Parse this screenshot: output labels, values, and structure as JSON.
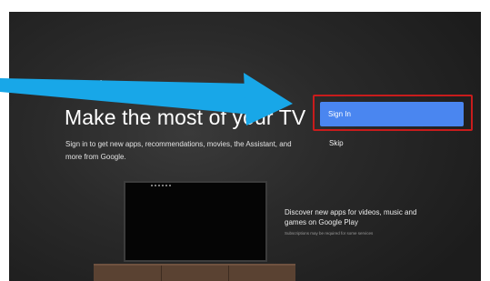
{
  "setup": {
    "brand": "Google",
    "headline": "Make the most of your TV",
    "subtitle": "Sign in to get new apps, recommendations, movies, the Assistant, and more from Google.",
    "signin_label": "Sign In",
    "skip_label": "Skip",
    "promo_title": "Discover new apps for videos, music and games on Google Play",
    "promo_note": "Subscriptions may be required for some services"
  },
  "colors": {
    "accent_button": "#4a86f0",
    "highlight_box": "#c81c1c",
    "annotation_arrow": "#18a7e8"
  }
}
